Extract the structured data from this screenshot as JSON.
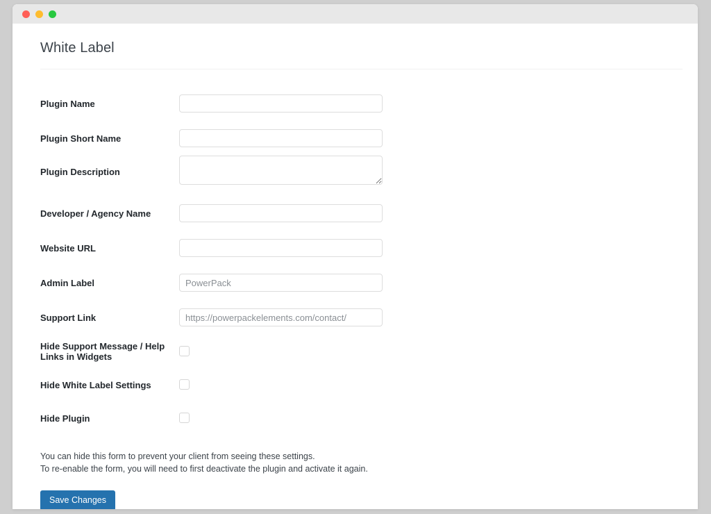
{
  "window": {
    "traffic_lights": [
      "close",
      "minimize",
      "maximize"
    ]
  },
  "page": {
    "title": "White Label"
  },
  "form": {
    "fields": [
      {
        "label": "Plugin Name",
        "type": "text",
        "value": "",
        "placeholder": ""
      },
      {
        "label": "Plugin Short Name",
        "type": "text",
        "value": "",
        "placeholder": ""
      },
      {
        "label": "Plugin Description",
        "type": "textarea",
        "value": "",
        "placeholder": ""
      },
      {
        "label": "Developer / Agency Name",
        "type": "text",
        "value": "",
        "placeholder": ""
      },
      {
        "label": "Website URL",
        "type": "text",
        "value": "",
        "placeholder": ""
      },
      {
        "label": "Admin Label",
        "type": "text",
        "value": "",
        "placeholder": "PowerPack"
      },
      {
        "label": "Support Link",
        "type": "text",
        "value": "",
        "placeholder": "https://powerpackelements.com/contact/"
      }
    ],
    "checkboxes": [
      {
        "label": "Hide Support Message / Help Links in Widgets",
        "checked": false
      },
      {
        "label": "Hide White Label Settings",
        "checked": false
      },
      {
        "label": "Hide Plugin",
        "checked": false
      }
    ],
    "help_text": [
      "You can hide this form to prevent your client from seeing these settings.",
      "To re-enable the form, you will need to first deactivate the plugin and activate it again."
    ],
    "save_label": "Save Changes"
  },
  "colors": {
    "button_blue": "#2572ae",
    "desktop_gray": "#cfcfcf",
    "titlebar_gray": "#e8e8e8"
  }
}
